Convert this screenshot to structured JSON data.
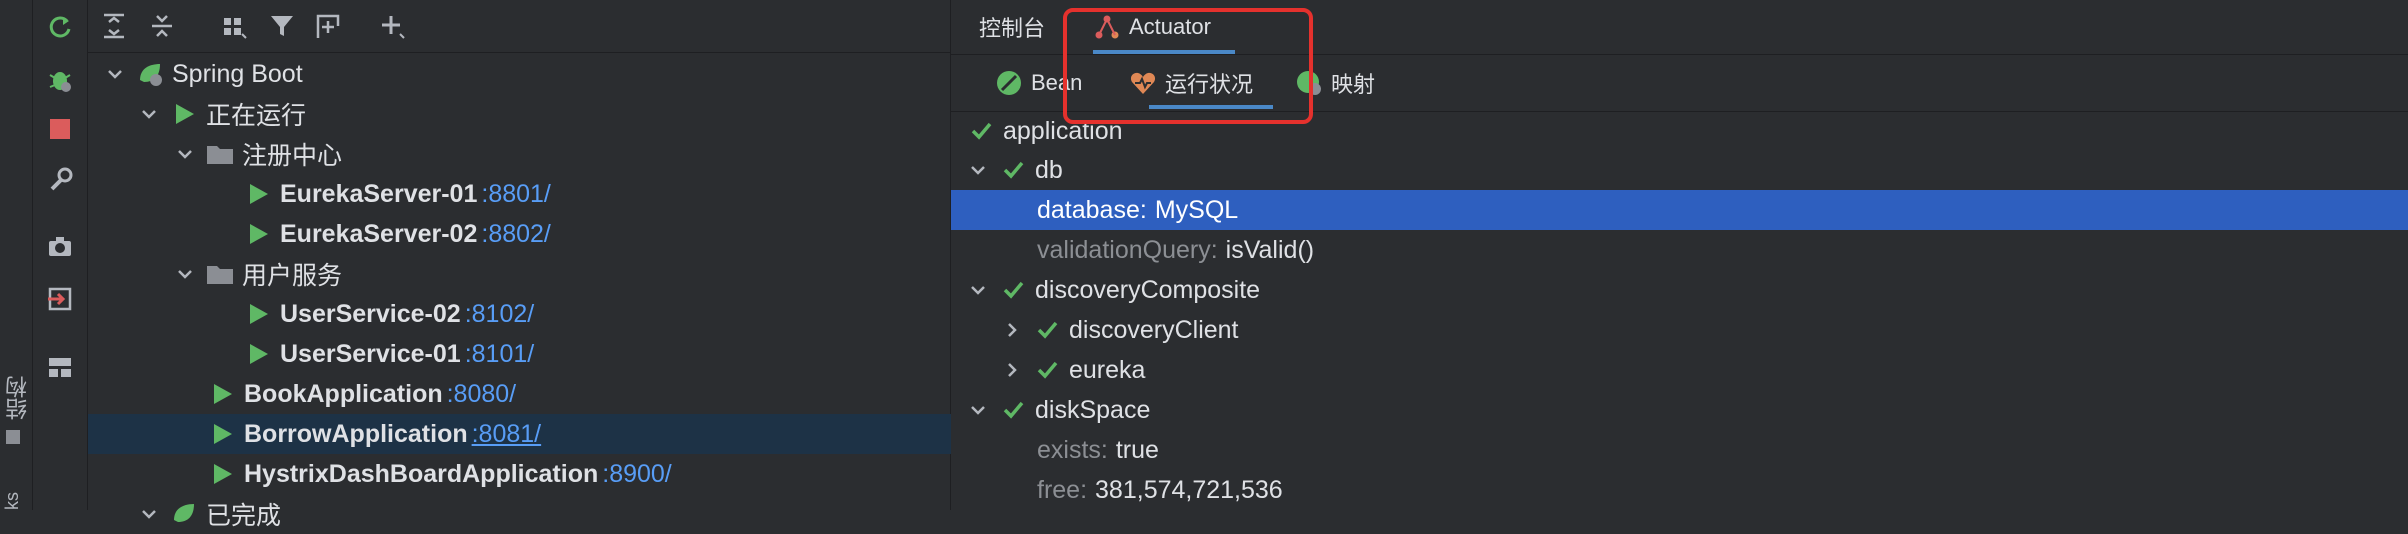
{
  "edge": {
    "label": "结构",
    "bottom": "ks"
  },
  "tree": {
    "rows": [
      {
        "label": "Spring Boot",
        "port": ""
      },
      {
        "label": "正在运行",
        "port": ""
      },
      {
        "label": "注册中心",
        "port": ""
      },
      {
        "label": "EurekaServer-01",
        "port": ":8801/"
      },
      {
        "label": "EurekaServer-02",
        "port": ":8802/"
      },
      {
        "label": "用户服务",
        "port": ""
      },
      {
        "label": "UserService-02",
        "port": ":8102/"
      },
      {
        "label": "UserService-01",
        "port": ":8101/"
      },
      {
        "label": "BookApplication",
        "port": ":8080/"
      },
      {
        "label": "BorrowApplication",
        "port": ":8081/"
      },
      {
        "label": "HystrixDashBoardApplication",
        "port": ":8900/"
      },
      {
        "label": "已完成",
        "port": ""
      }
    ]
  },
  "tabs": {
    "primary": [
      {
        "label": "控制台"
      },
      {
        "label": "Actuator"
      }
    ],
    "secondary": [
      {
        "label": "Bean"
      },
      {
        "label": "运行状况"
      },
      {
        "label": "映射"
      }
    ]
  },
  "health": {
    "rows": [
      {
        "key": "application",
        "value": ""
      },
      {
        "key": "db",
        "value": ""
      },
      {
        "key": "database:",
        "value": "MySQL"
      },
      {
        "key": "validationQuery:",
        "value": "isValid()"
      },
      {
        "key": "discoveryComposite",
        "value": ""
      },
      {
        "key": "discoveryClient",
        "value": ""
      },
      {
        "key": "eureka",
        "value": ""
      },
      {
        "key": "diskSpace",
        "value": ""
      },
      {
        "key": "exists:",
        "value": "true"
      },
      {
        "key": "free:",
        "value": "381,574,721,536"
      }
    ]
  },
  "colors": {
    "accent": "#4a88c7",
    "selection": "#2e5fbf",
    "highlight": "#e5312d",
    "check": "#5fb865",
    "link": "#589df6"
  }
}
